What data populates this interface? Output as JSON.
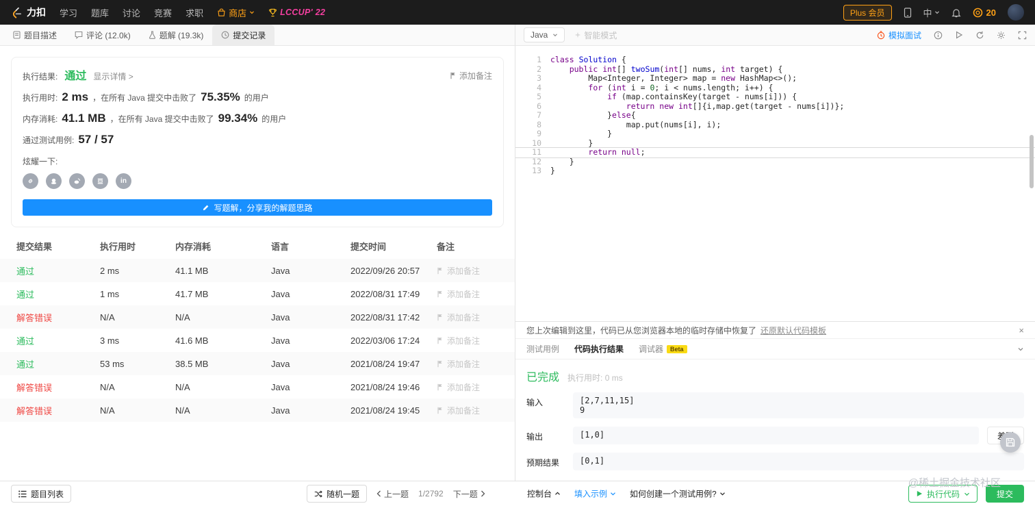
{
  "navbar": {
    "logo": "力扣",
    "menu": [
      "学习",
      "题库",
      "讨论",
      "竞赛",
      "求职"
    ],
    "store": "商店",
    "lccup": "LCCUP' 22",
    "plus": "Plus 会员",
    "lang": "中",
    "coins": "20"
  },
  "left_tabs": [
    {
      "label": "题目描述"
    },
    {
      "label": "评论 (12.0k)"
    },
    {
      "label": "题解 (19.3k)"
    },
    {
      "label": "提交记录"
    }
  ],
  "editor_toolbar": {
    "language": "Java",
    "smart_mode": "智能模式",
    "mock_interview": "模拟面试"
  },
  "result_card": {
    "result_label": "执行结果:",
    "result_status": "通过",
    "detail_link": "显示详情 >",
    "add_note": "添加备注",
    "runtime": {
      "label": "执行用时:",
      "value": "2 ms",
      "mid": "，在所有 Java 提交中击败了",
      "percent": "75.35%",
      "suffix": "的用户"
    },
    "memory": {
      "label": "内存消耗:",
      "value": "41.1 MB",
      "mid": "，在所有 Java 提交中击败了",
      "percent": "99.34%",
      "suffix": "的用户"
    },
    "testcase": {
      "label": "通过测试用例:",
      "value": "57 / 57"
    },
    "share_label": "炫耀一下:",
    "share_icons": [
      "share-link-icon",
      "share-qq-icon",
      "share-weibo-icon",
      "share-douban-icon",
      "share-linkedin-icon"
    ],
    "write_solution": "写题解，分享我的解题思路"
  },
  "table": {
    "headers": [
      "提交结果",
      "执行用时",
      "内存消耗",
      "语言",
      "提交时间",
      "备注"
    ],
    "note_label": "添加备注",
    "rows": [
      {
        "status": "通过",
        "state": "ok",
        "runtime": "2 ms",
        "memory": "41.1 MB",
        "lang": "Java",
        "time": "2022/09/26 20:57"
      },
      {
        "status": "通过",
        "state": "ok",
        "runtime": "1 ms",
        "memory": "41.7 MB",
        "lang": "Java",
        "time": "2022/08/31 17:49"
      },
      {
        "status": "解答错误",
        "state": "error",
        "runtime": "N/A",
        "memory": "N/A",
        "lang": "Java",
        "time": "2022/08/31 17:42"
      },
      {
        "status": "通过",
        "state": "ok",
        "runtime": "3 ms",
        "memory": "41.6 MB",
        "lang": "Java",
        "time": "2022/03/06 17:24"
      },
      {
        "status": "通过",
        "state": "ok",
        "runtime": "53 ms",
        "memory": "38.5 MB",
        "lang": "Java",
        "time": "2021/08/24 19:47"
      },
      {
        "status": "解答错误",
        "state": "error",
        "runtime": "N/A",
        "memory": "N/A",
        "lang": "Java",
        "time": "2021/08/24 19:46"
      },
      {
        "status": "解答错误",
        "state": "error",
        "runtime": "N/A",
        "memory": "N/A",
        "lang": "Java",
        "time": "2021/08/24 19:45"
      }
    ]
  },
  "code": {
    "language": "java",
    "highlight_line": 11,
    "lines": [
      [
        [
          "kw",
          "class"
        ],
        [
          "pl",
          " "
        ],
        [
          "def",
          "Solution"
        ],
        [
          "pl",
          " {"
        ]
      ],
      [
        [
          "pl",
          "    "
        ],
        [
          "kw",
          "public"
        ],
        [
          "pl",
          " "
        ],
        [
          "kw",
          "int"
        ],
        [
          "pl",
          "[] "
        ],
        [
          "def",
          "twoSum"
        ],
        [
          "pl",
          "("
        ],
        [
          "kw",
          "int"
        ],
        [
          "pl",
          "[] nums, "
        ],
        [
          "kw",
          "int"
        ],
        [
          "pl",
          " target) {"
        ]
      ],
      [
        [
          "pl",
          "        Map<Integer, Integer> map = "
        ],
        [
          "kw",
          "new"
        ],
        [
          "pl",
          " HashMap<>();"
        ]
      ],
      [
        [
          "pl",
          "        "
        ],
        [
          "kw",
          "for"
        ],
        [
          "pl",
          " ("
        ],
        [
          "kw",
          "int"
        ],
        [
          "pl",
          " i = "
        ],
        [
          "num",
          "0"
        ],
        [
          "pl",
          "; i < nums.length; i++) {"
        ]
      ],
      [
        [
          "pl",
          "            "
        ],
        [
          "kw",
          "if"
        ],
        [
          "pl",
          " (map.containsKey(target - nums[i])) {"
        ]
      ],
      [
        [
          "pl",
          "                "
        ],
        [
          "kw",
          "return"
        ],
        [
          "pl",
          " "
        ],
        [
          "kw",
          "new"
        ],
        [
          "pl",
          " "
        ],
        [
          "kw",
          "int"
        ],
        [
          "pl",
          "[]{i,map.get(target - nums[i])};"
        ]
      ],
      [
        [
          "pl",
          "            }"
        ],
        [
          "kw",
          "else"
        ],
        [
          "pl",
          "{"
        ]
      ],
      [
        [
          "pl",
          "                map.put(nums[i], i);"
        ]
      ],
      [
        [
          "pl",
          "            }"
        ]
      ],
      [
        [
          "pl",
          "        }"
        ]
      ],
      [
        [
          "pl",
          "        "
        ],
        [
          "kw",
          "return"
        ],
        [
          "pl",
          " "
        ],
        [
          "kw",
          "null"
        ],
        [
          "pl",
          ";"
        ]
      ],
      [
        [
          "pl",
          "    }"
        ]
      ],
      [
        [
          "pl",
          "}"
        ]
      ]
    ]
  },
  "console": {
    "notice": "您上次编辑到这里，代码已从您浏览器本地的临时存储中恢复了",
    "notice_link": "还原默认代码模板",
    "tabs": [
      "测试用例",
      "代码执行结果",
      "调试器"
    ],
    "beta": "Beta",
    "status": "已完成",
    "runtime_label": "执行用时:",
    "runtime_value": "0 ms",
    "input_label": "输入",
    "input_value": "[2,7,11,15]\n9",
    "output_label": "输出",
    "output_value": "[1,0]",
    "diff_label": "差别",
    "expected_label": "预期结果",
    "expected_value": "[0,1]"
  },
  "bottom_bar": {
    "problem_list": "题目列表",
    "random": "随机一题",
    "prev": "上一题",
    "counter": "1/2792",
    "next": "下一题",
    "console_toggle": "控制台",
    "fill_example": "填入示例",
    "howto": "如何创建一个测试用例?",
    "run_code": "执行代码",
    "submit": "提交"
  },
  "watermark": "@稀土掘金技术社区",
  "colors": {
    "accent_green": "#2cbb5d",
    "accent_red": "#ef4743",
    "accent_blue": "#1890ff",
    "accent_orange": "#ffa116"
  }
}
